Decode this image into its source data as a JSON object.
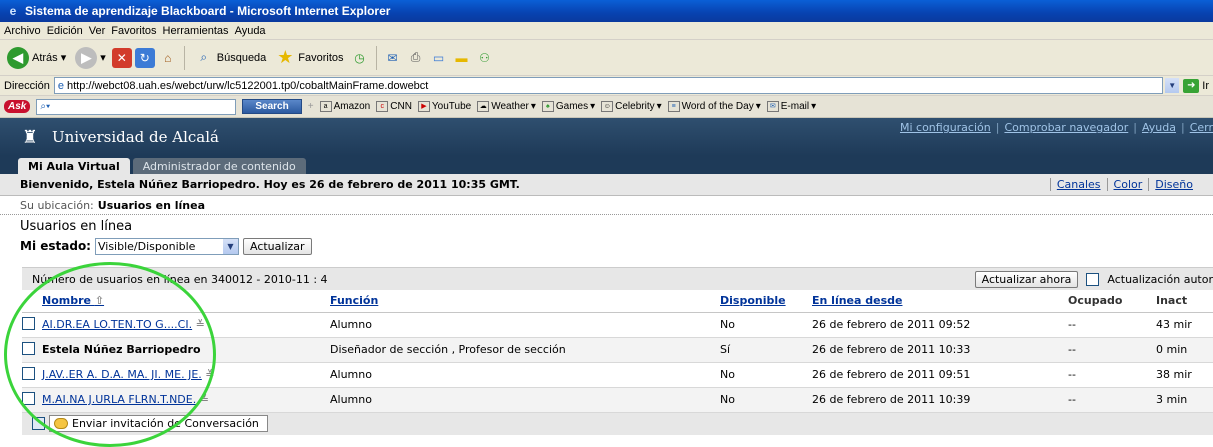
{
  "window": {
    "title": "Sistema de aprendizaje Blackboard - Microsoft Internet Explorer"
  },
  "menu": [
    "Archivo",
    "Edición",
    "Ver",
    "Favoritos",
    "Herramientas",
    "Ayuda"
  ],
  "toolbar": {
    "back": "Atrás",
    "search": "Búsqueda",
    "favorites": "Favoritos"
  },
  "address": {
    "label": "Dirección",
    "url": "http://webct08.uah.es/webct/urw/lc5122001.tp0/cobaltMainFrame.dowebct",
    "go": "Ir"
  },
  "askbar": {
    "logo": "Ask",
    "search": "Search",
    "items": [
      "Amazon",
      "CNN",
      "YouTube",
      "Weather",
      "Games",
      "Celebrity",
      "Word of the Day",
      "E-mail"
    ]
  },
  "header": {
    "institution": "Universidad de Alcalá",
    "links": [
      "Mi configuración",
      "Comprobar navegador",
      "Ayuda",
      "Cerr"
    ]
  },
  "tabs": [
    "Mi Aula Virtual",
    "Administrador de contenido"
  ],
  "welcome": {
    "text": "Bienvenido, Estela Núñez Barriopedro. Hoy es 26 de febrero de 2011 10:35 GMT.",
    "links": [
      "Canales",
      "Color",
      "Diseño"
    ]
  },
  "location": {
    "label": "Su ubicación:",
    "value": "Usuarios en línea"
  },
  "page_title": "Usuarios en línea",
  "status": {
    "label": "Mi estado:",
    "value": "Visible/Disponible",
    "update": "Actualizar"
  },
  "panel": {
    "count": "Número de usuarios en línea en 340012 - 2010-11 : 4",
    "update_now": "Actualizar ahora",
    "auto_update": "Actualización autor"
  },
  "table": {
    "headers": [
      "Nombre",
      "Función",
      "Disponible",
      "En línea desde",
      "Ocupado",
      "Inact"
    ],
    "rows": [
      {
        "name": "AI.DR.EA LO.TEN.TO G....CI.",
        "role": "Alumno",
        "available": "No",
        "since": "26 de febrero de 2011 09:52",
        "busy": "--",
        "idle": "43 mir"
      },
      {
        "name": "Estela Núñez Barriopedro",
        "role": "Diseñador de sección , Profesor de sección",
        "available": "Sí",
        "since": "26 de febrero de 2011 10:33",
        "busy": "--",
        "idle": "0 min"
      },
      {
        "name": "J.AV..ER A. D.A. MA. JI. ME. JE.",
        "role": "Alumno",
        "available": "No",
        "since": "26 de febrero de 2011 09:51",
        "busy": "--",
        "idle": "38 mir"
      },
      {
        "name": "M.AI.NA J.URLA FLRN.T.NDE.",
        "role": "Alumno",
        "available": "No",
        "since": "26 de febrero de 2011 10:39",
        "busy": "--",
        "idle": "3 min"
      }
    ]
  },
  "invite": "Enviar invitación de Conversación"
}
